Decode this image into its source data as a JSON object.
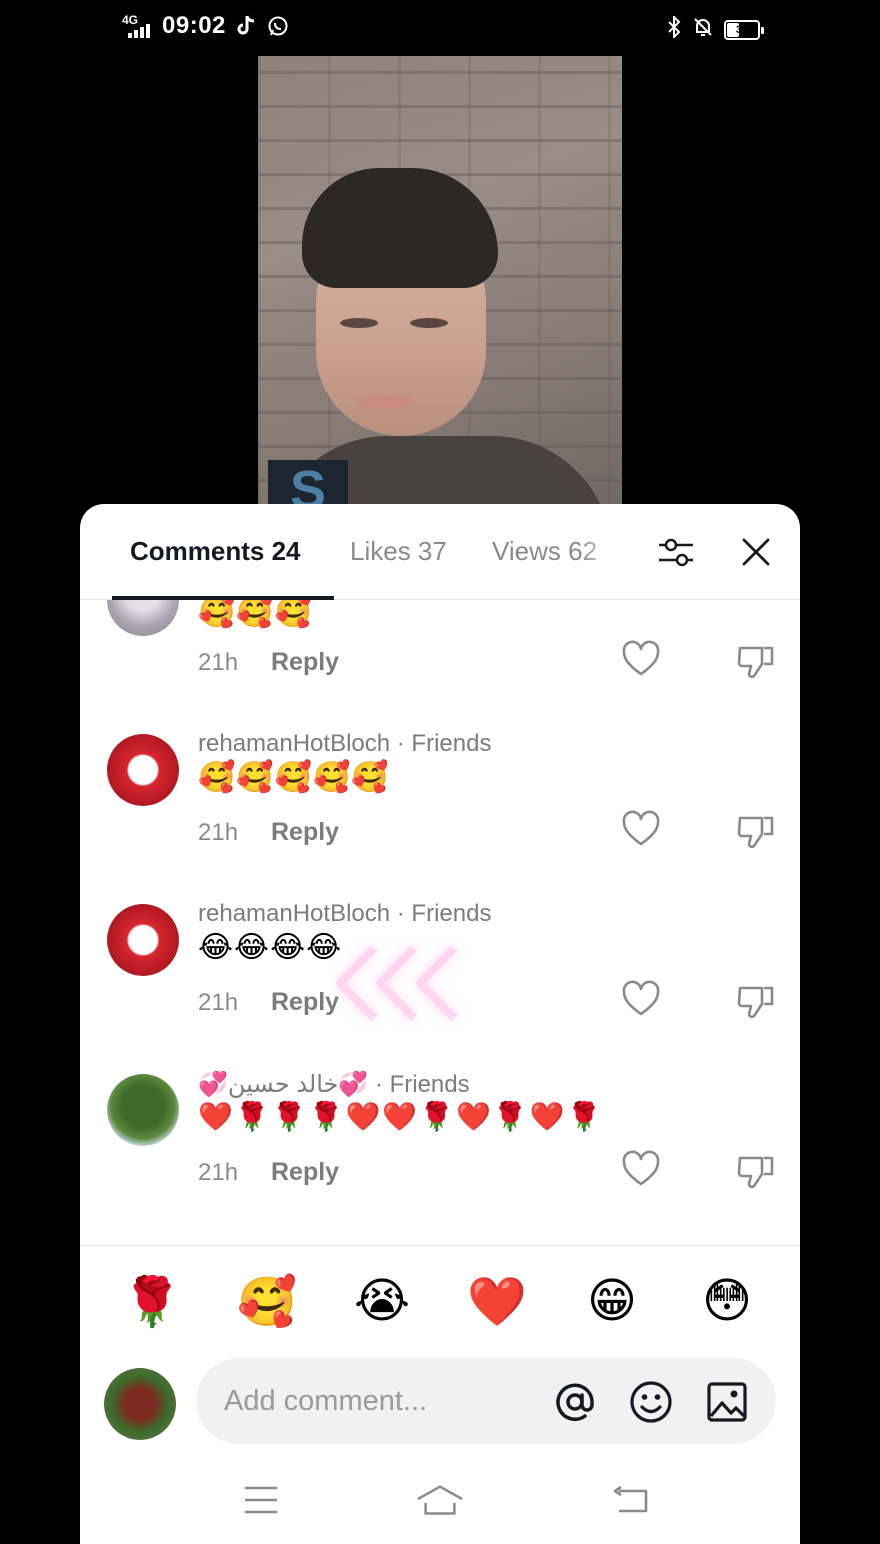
{
  "status_bar": {
    "network": "4G",
    "time": "09:02",
    "battery": "38",
    "battery_level": 0.38
  },
  "tabs": {
    "comments_label": "Comments 24",
    "likes_label": "Likes 37",
    "views_label": "Views 62",
    "filter_icon": "sliders-icon",
    "close_icon": "close-icon"
  },
  "comments": [
    {
      "name": "",
      "text": "🥰🥰🥰",
      "time": "21h",
      "reply": "Reply"
    },
    {
      "name": "rehamanHotBloch · Friends",
      "text": "🥰🥰🥰🥰🥰",
      "time": "21h",
      "reply": "Reply"
    },
    {
      "name": "rehamanHotBloch · Friends",
      "text": "😂😂😂😂",
      "time": "21h",
      "reply": "Reply"
    },
    {
      "name": "💞خالد حسین💞 · Friends",
      "text": "❤️🌹🌹🌹❤️❤️🌹❤️🌹❤️🌹",
      "time": "21h",
      "reply": "Reply"
    }
  ],
  "quick_emojis": [
    "🌹",
    "🥰",
    "😭",
    "❤️",
    "😁",
    "😳"
  ],
  "composer": {
    "placeholder": "Add comment...",
    "mention_icon": "at-icon",
    "emoji_icon": "smiley-icon",
    "image_icon": "image-icon"
  },
  "colors": {
    "accent": "#161823",
    "muted": "#8a8a8a",
    "sheet_bg": "#ffffff"
  }
}
